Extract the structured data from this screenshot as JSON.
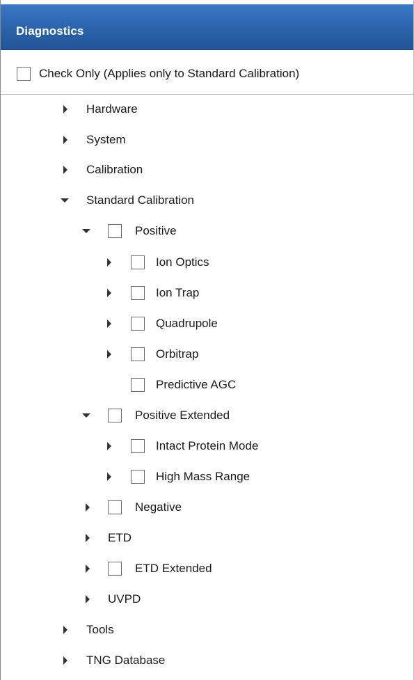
{
  "header": {
    "title": "Diagnostics"
  },
  "check_only": {
    "label": "Check Only (Applies only to Standard Calibration)",
    "checked": false
  },
  "tree": {
    "hardware": {
      "label": "Hardware",
      "icon": "expand-arrow-right"
    },
    "system": {
      "label": "System",
      "icon": "expand-arrow-right"
    },
    "calibration": {
      "label": "Calibration",
      "icon": "expand-arrow-right"
    },
    "standard_calibration": {
      "label": "Standard Calibration",
      "icon": "collapse-arrow-down",
      "positive": {
        "label": "Positive",
        "checked": false,
        "children": {
          "ion_optics": {
            "label": "Ion Optics",
            "checked": false
          },
          "ion_trap": {
            "label": "Ion Trap",
            "checked": false
          },
          "quadrupole": {
            "label": "Quadrupole",
            "checked": false
          },
          "orbitrap": {
            "label": "Orbitrap",
            "checked": false
          },
          "predictive_agc": {
            "label": "Predictive AGC",
            "checked": false
          }
        }
      },
      "positive_extended": {
        "label": "Positive Extended",
        "checked": false,
        "children": {
          "intact_protein_mode": {
            "label": "Intact Protein Mode",
            "checked": false
          },
          "high_mass_range": {
            "label": "High Mass Range",
            "checked": false
          }
        }
      },
      "negative": {
        "label": "Negative",
        "checked": false
      },
      "etd": {
        "label": "ETD"
      },
      "etd_extended": {
        "label": "ETD Extended",
        "checked": false
      },
      "uvpd": {
        "label": "UVPD"
      }
    },
    "tools": {
      "label": "Tools",
      "icon": "expand-arrow-right"
    },
    "tng_database": {
      "label": "TNG Database",
      "icon": "expand-arrow-right"
    }
  }
}
